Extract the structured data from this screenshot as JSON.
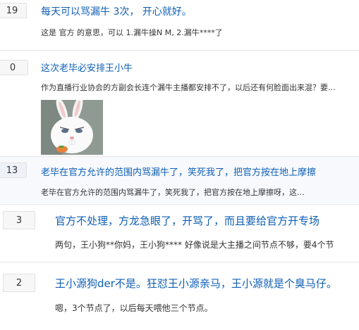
{
  "posts": [
    {
      "count": "19",
      "title": "每天可以骂漏牛 3次， 开心就好。",
      "excerpt": "这是 官方 的意思，可以 1.漏牛操N M, 2.漏牛****了"
    },
    {
      "count": "0",
      "title": "这次老毕必安排王小牛",
      "excerpt": "作为直播行业协会的方副会长连个漏牛主播都安排不了，以后还有何脸面出来混？要..."
    },
    {
      "count": "13",
      "title": "老毕在官方允许的范围内骂漏牛了，笑死我了，把官方按在地上摩擦",
      "excerpt": "老毕在官方允许的范围内骂漏牛了，笑死我了，把官方按在地上摩擦呀，这..."
    },
    {
      "count": "3",
      "title": "官方不处理，方龙急眼了，开骂了，而且要给官方开专场",
      "excerpt": "两句，王小狗**你妈，王小狗**** 好像说是大主播之间节点不够，要4个节"
    },
    {
      "count": "2",
      "title": "王小源狗der不是。狂怼王小源亲马，王小源就是个臭马仔。",
      "excerpt": "嗯，3个节点了，以后每天喂他三个节点。"
    }
  ]
}
